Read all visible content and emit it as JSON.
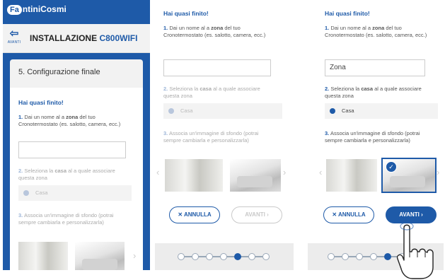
{
  "brand": {
    "logo_prefix": "Fa",
    "logo_text": "ntiniCosmi"
  },
  "appbar": {
    "back_label": "AVANTI",
    "title": "INSTALLAZIONE",
    "model": "C800WIFI"
  },
  "step": {
    "title": "5. Configurazione finale"
  },
  "form": {
    "heading": "Hai quasi finito!",
    "q1": {
      "num": "1.",
      "pre": "Dai un nome al a ",
      "bold": "zona",
      "post": " del tuo Cronotermostato (es. salotto, camera, ecc.)"
    },
    "q2": {
      "num": "2.",
      "pre": "Seleziona la ",
      "bold": "casa",
      "post": " al a quale associare questa zona"
    },
    "q3": {
      "num": "3.",
      "text": "Associa un'immagine di sfondo (potrai sempre cambiarla e personalizzarla)"
    },
    "house_option": "Casa",
    "zone_value_empty": "",
    "zone_value_filled": "Zona"
  },
  "buttons": {
    "cancel": "✕ ANNULLA",
    "next": "AVANTI ›"
  },
  "pager": {
    "total": 7,
    "current": 5
  },
  "colors": {
    "brand_blue": "#1e5aa8",
    "background": "#ffffff",
    "muted": "#aaaaaa"
  },
  "icons": [
    "back-arrow-icon",
    "radio-dot-icon",
    "chevron-left-icon",
    "chevron-right-icon",
    "checkmark-icon",
    "hand-pointer-icon"
  ]
}
